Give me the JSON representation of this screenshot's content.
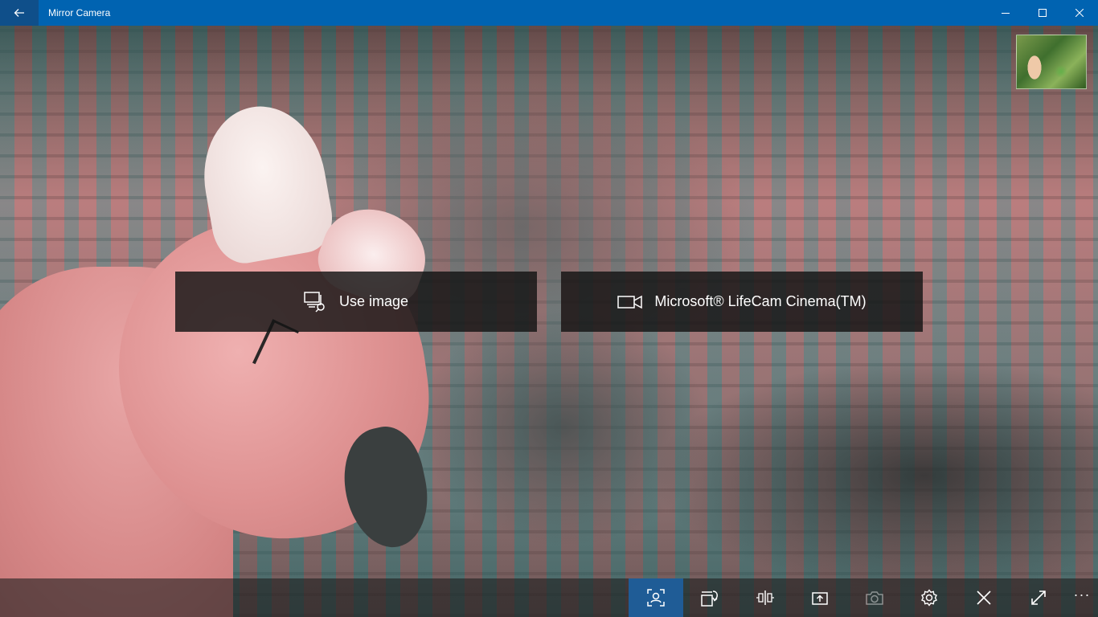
{
  "window": {
    "title": "Mirror Camera"
  },
  "titlebar_icons": {
    "back": "back-arrow-icon",
    "minimize": "minimize-icon",
    "maximize": "maximize-icon",
    "close": "close-icon"
  },
  "sources": [
    {
      "label": "Use image",
      "icon": "image-search-icon"
    },
    {
      "label": "Microsoft® LifeCam Cinema(TM)",
      "icon": "video-camera-icon"
    }
  ],
  "command_bar": {
    "items": [
      {
        "icon": "face-tracking-icon",
        "active": true
      },
      {
        "icon": "rotate-icon",
        "active": false
      },
      {
        "icon": "flip-horizontal-icon",
        "active": false
      },
      {
        "icon": "upload-icon",
        "active": false
      },
      {
        "icon": "camera-icon",
        "active": false,
        "disabled": true
      },
      {
        "icon": "settings-gear-icon",
        "active": false
      },
      {
        "icon": "close-icon",
        "active": false
      },
      {
        "icon": "expand-fullscreen-icon",
        "active": false
      }
    ],
    "more": "···"
  },
  "colors": {
    "titlebar": "#0063b1",
    "active_command": "#1f5c96",
    "button_overlay": "#141414"
  }
}
